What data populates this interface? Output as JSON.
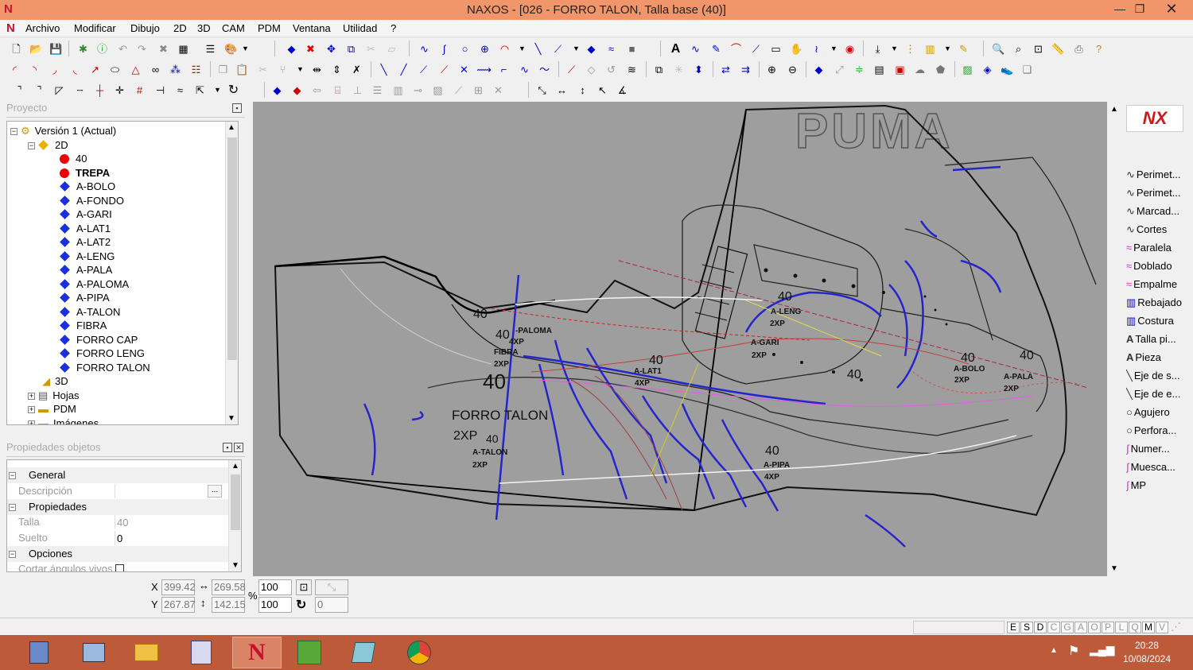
{
  "window": {
    "title": "NAXOS - [026 - FORRO TALON, Talla base (40)]",
    "logo": "N"
  },
  "menu": [
    "Archivo",
    "Modificar",
    "Dibujo",
    "2D",
    "3D",
    "CAM",
    "PDM",
    "Ventana",
    "Utilidad",
    "?"
  ],
  "project": {
    "panel_title": "Proyecto",
    "items": [
      {
        "label": "Versión 1 (Actual)",
        "kind": "version",
        "expanded": true
      },
      {
        "label": "2D",
        "kind": "folder2d",
        "expanded": true
      },
      {
        "label": "40",
        "kind": "red"
      },
      {
        "label": "TREPA",
        "kind": "red",
        "bold": true
      },
      {
        "label": "A-BOLO",
        "kind": "blue"
      },
      {
        "label": "A-FONDO",
        "kind": "blue"
      },
      {
        "label": "A-GARI",
        "kind": "blue"
      },
      {
        "label": "A-LAT1",
        "kind": "blue"
      },
      {
        "label": "A-LAT2",
        "kind": "blue"
      },
      {
        "label": "A-LENG",
        "kind": "blue"
      },
      {
        "label": "A-PALA",
        "kind": "blue"
      },
      {
        "label": "A-PALOMA",
        "kind": "blue"
      },
      {
        "label": "A-PIPA",
        "kind": "blue"
      },
      {
        "label": "A-TALON",
        "kind": "blue"
      },
      {
        "label": "FIBRA",
        "kind": "blue"
      },
      {
        "label": "FORRO CAP",
        "kind": "blue"
      },
      {
        "label": "FORRO LENG",
        "kind": "blue"
      },
      {
        "label": "FORRO TALON",
        "kind": "blue"
      },
      {
        "label": "3D",
        "kind": "folder3d"
      },
      {
        "label": "Hojas",
        "kind": "folder"
      },
      {
        "label": "PDM",
        "kind": "folder"
      },
      {
        "label": "Imágenes",
        "kind": "folder"
      }
    ]
  },
  "properties": {
    "panel_title": "Propiedades objetos",
    "groups": [
      {
        "name": "General",
        "rows": [
          {
            "key": "Descripción",
            "value": "",
            "button": "..."
          }
        ]
      },
      {
        "name": "Propiedades",
        "rows": [
          {
            "key": "Talla",
            "value": "40"
          },
          {
            "key": "Suelto",
            "value": "0"
          }
        ]
      },
      {
        "name": "Opciones",
        "rows": [
          {
            "key": "Cortar ángulos vivos",
            "value": ""
          }
        ]
      }
    ]
  },
  "canvas": {
    "brand": "PUMA",
    "labels": [
      {
        "text": "40"
      },
      {
        "text": "40"
      },
      {
        "text": "-PALOMA"
      },
      {
        "text": "4XP"
      },
      {
        "text": "FIBRA"
      },
      {
        "text": "2XP"
      },
      {
        "text": "40"
      },
      {
        "text": "FORRO TALON"
      },
      {
        "text": "2XP"
      },
      {
        "text": "40"
      },
      {
        "text": "A-TALON"
      },
      {
        "text": "2XP"
      },
      {
        "text": "40"
      },
      {
        "text": "A-LAT1"
      },
      {
        "text": "4XP"
      },
      {
        "text": "40"
      },
      {
        "text": "A-LENG"
      },
      {
        "text": "2XP"
      },
      {
        "text": "A-GARI"
      },
      {
        "text": "2XP"
      },
      {
        "text": "40"
      },
      {
        "text": "40"
      },
      {
        "text": "A-BOLO"
      },
      {
        "text": "2XP"
      },
      {
        "text": "40"
      },
      {
        "text": "A-PALA"
      },
      {
        "text": "2XP"
      },
      {
        "text": "40"
      },
      {
        "text": "A-PIPA"
      },
      {
        "text": "4XP"
      }
    ]
  },
  "right_tools": [
    "Perimet...",
    "Perimet...",
    "Marcad...",
    "Cortes",
    "Paralela",
    "Doblado",
    "Empalme",
    "Rebajado",
    "Costura",
    "Talla pi...",
    "Pieza",
    "Eje de s...",
    "Eje de e...",
    "Agujero",
    "Perfora...",
    "Numer...",
    "Muesca...",
    "MP"
  ],
  "coords": {
    "x_label": "X",
    "y_label": "Y",
    "x": "399.42",
    "y": "267.87",
    "width": "269.58",
    "height": "142.15",
    "pct_label": "%",
    "scale_x": "100",
    "scale_y": "100",
    "rotation": "0"
  },
  "status_letters": [
    "E",
    "S",
    "D",
    "C",
    "G",
    "A",
    "O",
    "P",
    "L",
    "Q",
    "M",
    "V"
  ],
  "status_on": [
    true,
    true,
    true,
    false,
    false,
    false,
    false,
    false,
    false,
    false,
    true,
    false
  ],
  "clock": {
    "time": "20:28",
    "date": "10/08/2024"
  }
}
